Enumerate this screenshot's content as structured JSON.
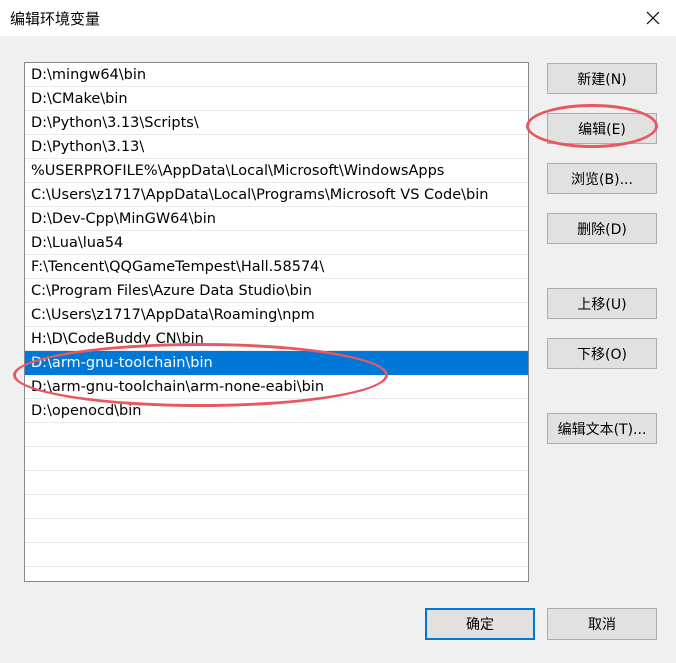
{
  "window": {
    "title": "编辑环境变量"
  },
  "list": {
    "items": [
      "D:\\mingw64\\bin",
      "D:\\CMake\\bin",
      "D:\\Python\\3.13\\Scripts\\",
      "D:\\Python\\3.13\\",
      "%USERPROFILE%\\AppData\\Local\\Microsoft\\WindowsApps",
      "C:\\Users\\z1717\\AppData\\Local\\Programs\\Microsoft VS Code\\bin",
      "D:\\Dev-Cpp\\MinGW64\\bin",
      "D:\\Lua\\lua54",
      "F:\\Tencent\\QQGameTempest\\Hall.58574\\",
      "C:\\Program Files\\Azure Data Studio\\bin",
      "C:\\Users\\z1717\\AppData\\Roaming\\npm",
      "H:\\D\\CodeBuddy CN\\bin",
      "D:\\arm-gnu-toolchain\\bin",
      "D:\\arm-gnu-toolchain\\arm-none-eabi\\bin",
      "D:\\openocd\\bin"
    ],
    "selected_index": 12
  },
  "buttons": {
    "new": "新建(N)",
    "edit": "编辑(E)",
    "browse": "浏览(B)...",
    "delete": "删除(D)",
    "move_up": "上移(U)",
    "move_down": "下移(O)",
    "edit_text": "编辑文本(T)...",
    "ok": "确定",
    "cancel": "取消"
  },
  "colors": {
    "selection": "#0078d7",
    "annotation": "#e8585f"
  },
  "icons": {
    "close": "close-icon"
  }
}
